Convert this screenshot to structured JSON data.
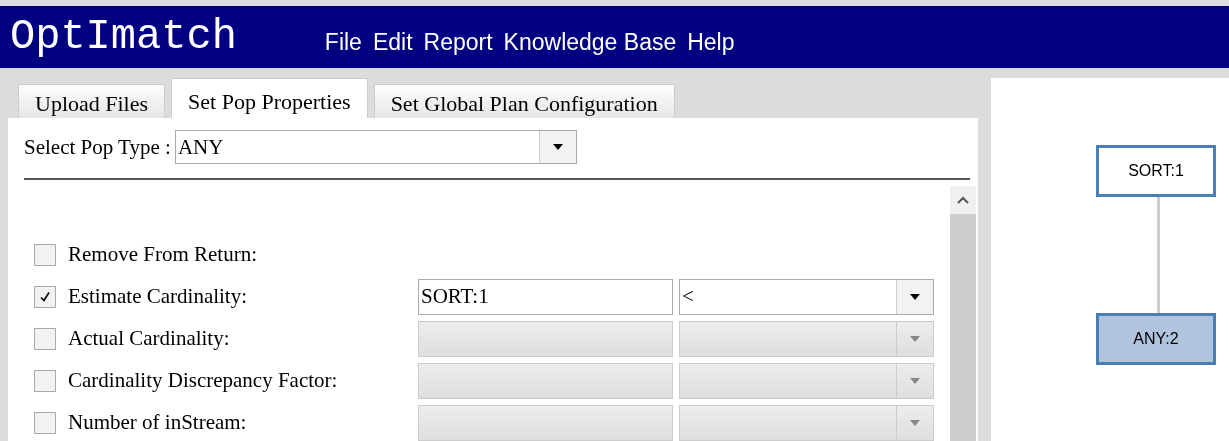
{
  "app": {
    "logo": "OptImatch"
  },
  "menu": [
    "File",
    "Edit",
    "Report",
    "Knowledge Base",
    "Help"
  ],
  "tabs": [
    {
      "label": "Upload Files",
      "selected": false
    },
    {
      "label": "Set Pop Properties",
      "selected": true
    },
    {
      "label": "Set Global Plan Configuration",
      "selected": false
    }
  ],
  "pop_type": {
    "label": "Select Pop Type :",
    "value": "ANY"
  },
  "properties": [
    {
      "label": "Remove From Return:",
      "checked": false
    },
    {
      "label": "Estimate Cardinality:",
      "checked": true,
      "fields": {
        "disabled": false,
        "value": "SORT:1",
        "operator": "<"
      }
    },
    {
      "label": "Actual Cardinality:",
      "checked": false,
      "fields": {
        "disabled": true
      }
    },
    {
      "label": "Cardinality Discrepancy Factor:",
      "checked": false,
      "fields": {
        "disabled": true
      }
    },
    {
      "label": "Number of inStream:",
      "checked": false,
      "fields": {
        "disabled": true
      }
    }
  ],
  "plan_graph": {
    "nodes": [
      {
        "label": "SORT:1",
        "selected": false
      },
      {
        "label": "ANY:2",
        "selected": true
      }
    ]
  }
}
